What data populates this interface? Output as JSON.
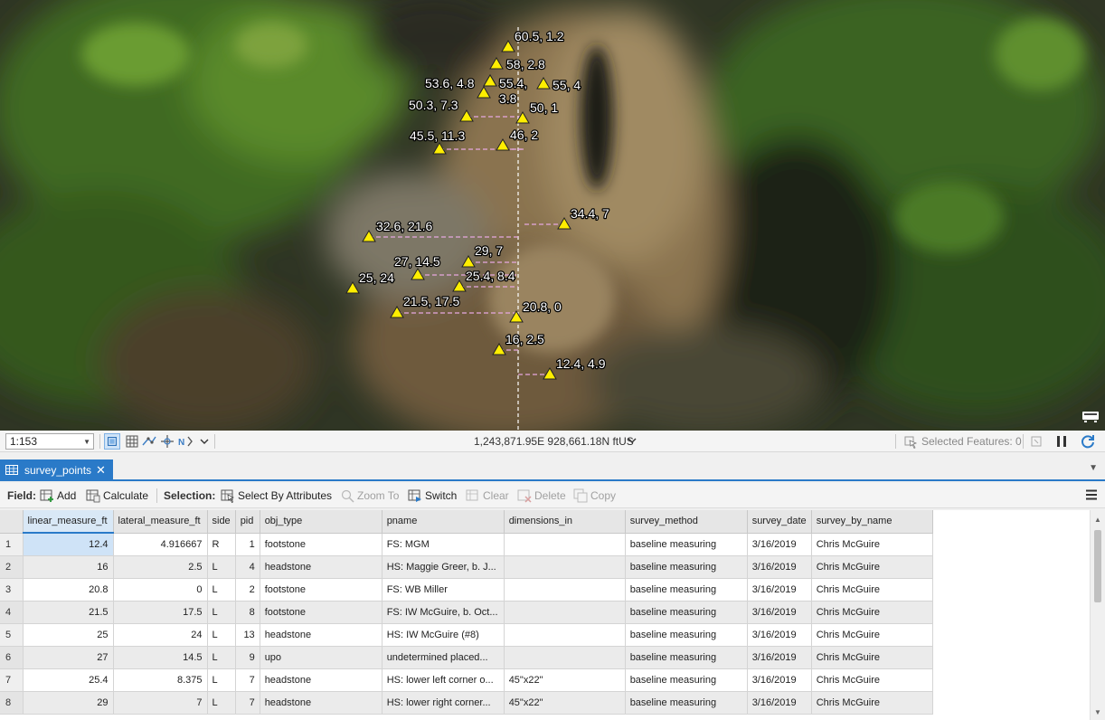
{
  "map": {
    "points": [
      {
        "label": "60.5, 1.2"
      },
      {
        "label": "58, 2.8"
      },
      {
        "label": "53.6, 4.8"
      },
      {
        "label": "55.4,"
      },
      {
        "label": "55, 4"
      },
      {
        "label": "3.8"
      },
      {
        "label": "50.3, 7.3"
      },
      {
        "label": "50, 1"
      },
      {
        "label": "45.5, 11.3"
      },
      {
        "label": "46, 2"
      },
      {
        "label": "34.4, 7"
      },
      {
        "label": "32.6, 21.6"
      },
      {
        "label": "29, 7"
      },
      {
        "label": "27, 14.5"
      },
      {
        "label": "25.4, 8.4"
      },
      {
        "label": "25, 24"
      },
      {
        "label": "21.5, 17.5"
      },
      {
        "label": "20.8, 0"
      },
      {
        "label": "16, 2.5"
      },
      {
        "label": "12.4, 4.9"
      }
    ],
    "colors": {
      "marker_fill": "#ffee00",
      "label_text": "#ffffff",
      "baseline": "#ffffff",
      "offset_line": "#e6a8e0"
    }
  },
  "statusbar": {
    "scale": "1:153",
    "coordinates": "1,243,871.95E 928,661.18N ftUS",
    "selected_features": "Selected Features: 0"
  },
  "tab": {
    "name": "survey_points"
  },
  "toolbar": {
    "field_label": "Field:",
    "add": "Add",
    "calculate": "Calculate",
    "selection_label": "Selection:",
    "select_by_attributes": "Select By Attributes",
    "zoom_to": "Zoom To",
    "switch": "Switch",
    "clear": "Clear",
    "delete": "Delete",
    "copy": "Copy"
  },
  "table": {
    "columns": [
      "linear_measure_ft",
      "lateral_measure_ft",
      "side",
      "pid",
      "obj_type",
      "pname",
      "dimensions_in",
      "survey_method",
      "survey_date",
      "survey_by_name"
    ],
    "rows": [
      [
        "1",
        "12.4",
        "4.916667",
        "R",
        "1",
        "footstone",
        "FS: MGM",
        "",
        "baseline measuring",
        "3/16/2019",
        "Chris McGuire"
      ],
      [
        "2",
        "16",
        "2.5",
        "L",
        "4",
        "headstone",
        "HS: Maggie Greer, b. J...",
        "",
        "baseline measuring",
        "3/16/2019",
        "Chris McGuire"
      ],
      [
        "3",
        "20.8",
        "0",
        "L",
        "2",
        "footstone",
        "FS: WB Miller",
        "",
        "baseline measuring",
        "3/16/2019",
        "Chris McGuire"
      ],
      [
        "4",
        "21.5",
        "17.5",
        "L",
        "8",
        "footstone",
        "FS: IW McGuire, b. Oct...",
        "",
        "baseline measuring",
        "3/16/2019",
        "Chris McGuire"
      ],
      [
        "5",
        "25",
        "24",
        "L",
        "13",
        "headstone",
        "HS: IW McGuire (#8)",
        "",
        "baseline measuring",
        "3/16/2019",
        "Chris McGuire"
      ],
      [
        "6",
        "27",
        "14.5",
        "L",
        "9",
        "upo",
        "undetermined placed...",
        "",
        "baseline measuring",
        "3/16/2019",
        "Chris McGuire"
      ],
      [
        "7",
        "25.4",
        "8.375",
        "L",
        "7",
        "headstone",
        "HS: lower left corner o...",
        "45\"x22\"",
        "baseline measuring",
        "3/16/2019",
        "Chris McGuire"
      ],
      [
        "8",
        "29",
        "7",
        "L",
        "7",
        "headstone",
        "HS: lower right corner...",
        "45\"x22\"",
        "baseline measuring",
        "3/16/2019",
        "Chris McGuire"
      ]
    ]
  }
}
